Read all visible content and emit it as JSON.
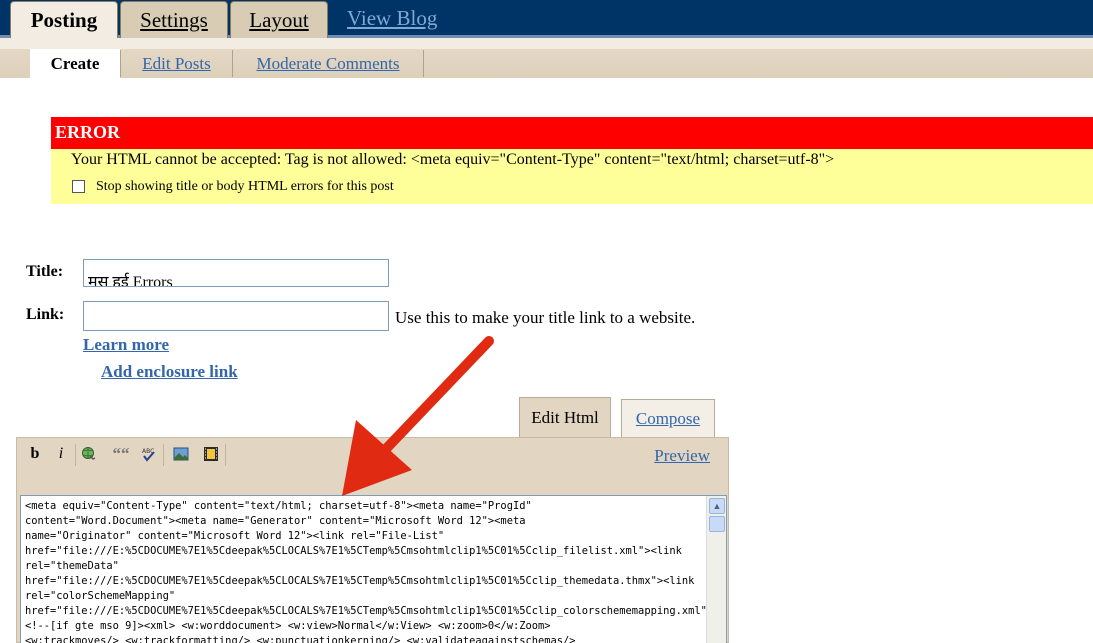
{
  "top_tabs": [
    {
      "label": "Posting"
    },
    {
      "label": "Settings"
    },
    {
      "label": "Layout"
    }
  ],
  "view_blog": "View Blog",
  "sub_tabs": {
    "create": "Create",
    "edit_posts": "Edit Posts",
    "moderate_comments": "Moderate Comments"
  },
  "error": {
    "heading": "ERROR",
    "message": "Your HTML cannot be accepted: Tag is not allowed: <meta equiv=\"Content-Type\" content=\"text/html; charset=utf-8\">",
    "checkbox_label": "Stop showing title or body HTML errors for this post",
    "colors": {
      "header": "#ff0000",
      "body": "#ffff99"
    }
  },
  "form": {
    "title_label": "Title:",
    "title_value": "मस हुई Errors",
    "link_label": "Link:",
    "link_value": "",
    "link_hint": "Use this to make your title link to a website.",
    "learn_more": "Learn more",
    "add_enclosure": "Add enclosure link"
  },
  "editor": {
    "tab_edit_html": "Edit Html",
    "tab_compose": "Compose",
    "preview": "Preview",
    "toolbar": {
      "bold": "b",
      "italic": "i",
      "link_icon": "globe-link-icon",
      "blockquote": "““",
      "spellcheck_icon": "spellcheck-icon",
      "image_icon": "image-icon",
      "video_icon": "video-icon"
    },
    "code_lines": [
      "<meta equiv=\"Content-Type\" content=\"text/html; charset=utf-8\"><meta name=\"ProgId\"",
      "content=\"Word.Document\"><meta name=\"Generator\" content=\"Microsoft Word 12\"><meta",
      "name=\"Originator\" content=\"Microsoft Word 12\"><link rel=\"File-List\"",
      "href=\"file:///E:%5CDOCUME%7E1%5Cdeepak%5CLOCALS%7E1%5CTemp%5Cmsohtmlclip1%5C01%5Cclip_filelist.xml\"><link",
      "rel=\"themeData\"",
      "href=\"file:///E:%5CDOCUME%7E1%5Cdeepak%5CLOCALS%7E1%5CTemp%5Cmsohtmlclip1%5C01%5Cclip_themedata.thmx\"><link",
      "rel=\"colorSchemeMapping\"",
      "href=\"file:///E:%5CDOCUME%7E1%5Cdeepak%5CLOCALS%7E1%5CTemp%5Cmsohtmlclip1%5C01%5Cclip_colorschememapping.xml\">",
      "<!--[if gte mso 9]><xml>  <w:worddocument>   <w:view>Normal</w:View>   <w:zoom>0</w:Zoom>",
      "<w:trackmoves/>   <w:trackformatting/>   <w:punctuationkerning/>   <w:validateagainstschemas/>"
    ]
  },
  "annotation": {
    "arrow_color": "#e02a12"
  }
}
